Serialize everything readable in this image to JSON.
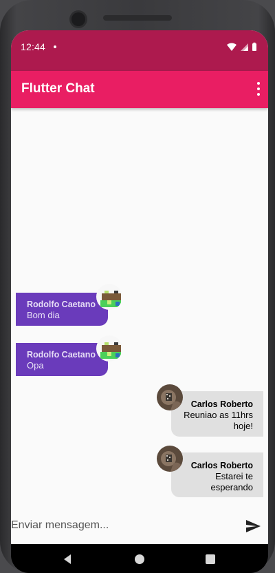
{
  "status_bar": {
    "time": "12:44"
  },
  "app_bar": {
    "title": "Flutter Chat",
    "menu_icon": "more-vert-icon"
  },
  "messages": [
    {
      "side": "left",
      "sender": "Rodolfo Caetano",
      "lines": [
        "Bom dia"
      ]
    },
    {
      "side": "left",
      "sender": "Rodolfo Caetano",
      "lines": [
        "Opa"
      ]
    },
    {
      "side": "right",
      "sender": "Carlos Roberto",
      "lines": [
        "Reuniao as 11hrs",
        "hoje!"
      ]
    },
    {
      "side": "right",
      "sender": "Carlos Roberto",
      "lines": [
        "Estarei te",
        "esperando"
      ]
    }
  ],
  "composer": {
    "placeholder": "Enviar mensagem...",
    "send_icon": "send-icon"
  },
  "colors": {
    "status_bar": "#ad1a4e",
    "app_bar": "#e91e63",
    "left_bubble": "#6a3bbb",
    "right_bubble": "#e0e0e0"
  }
}
